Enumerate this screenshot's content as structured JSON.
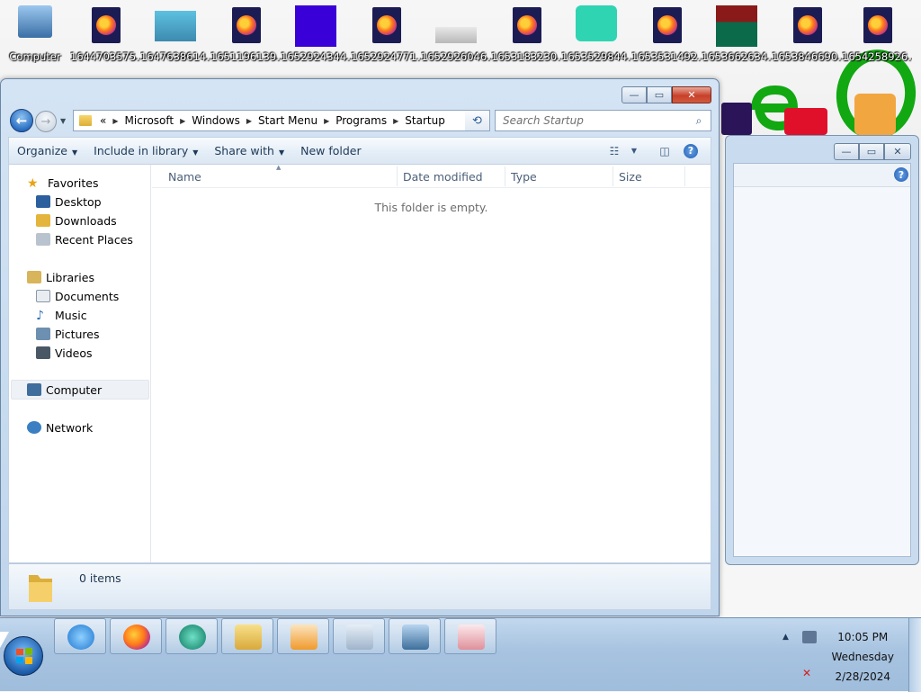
{
  "desktop": {
    "icons": [
      {
        "label": "Computer",
        "kind": "computer"
      },
      {
        "label": "1644703575....",
        "kind": "firefox-file"
      },
      {
        "label": "1647638614....",
        "kind": "image-cat"
      },
      {
        "label": "1651196139....",
        "kind": "firefox-file"
      },
      {
        "label": "1652924344....",
        "kind": "image-purple"
      },
      {
        "label": "1652924771....",
        "kind": "firefox-file"
      },
      {
        "label": "1652926046....",
        "kind": "image-gray"
      },
      {
        "label": "1653183230....",
        "kind": "firefox-file"
      },
      {
        "label": "1653529844....",
        "kind": "image-teal"
      },
      {
        "label": "1653531492....",
        "kind": "firefox-file"
      },
      {
        "label": "1653662634....",
        "kind": "image-fox"
      },
      {
        "label": "1653846690....",
        "kind": "firefox-file"
      },
      {
        "label": "1654258926....",
        "kind": "firefox-file"
      }
    ]
  },
  "explorer": {
    "caption_buttons": {
      "minimize": "—",
      "maximize": "▭",
      "close": "✕"
    },
    "nav": {
      "back": "←",
      "forward": "→",
      "overflow": "«"
    },
    "breadcrumb": [
      "Microsoft",
      "Windows",
      "Start Menu",
      "Programs",
      "Startup"
    ],
    "search_placeholder": "Search Startup",
    "toolbar": {
      "organize": "Organize",
      "include_in_library": "Include in library",
      "share_with": "Share with",
      "new_folder": "New folder",
      "help": "?"
    },
    "nav_pane": {
      "favorites": "Favorites",
      "favorites_items": [
        "Desktop",
        "Downloads",
        "Recent Places"
      ],
      "libraries": "Libraries",
      "libraries_items": [
        "Documents",
        "Music",
        "Pictures",
        "Videos"
      ],
      "computer": "Computer",
      "network": "Network"
    },
    "columns": [
      "Name",
      "Date modified",
      "Type",
      "Size"
    ],
    "empty_message": "This folder is empty.",
    "details": {
      "item_count": "0 items"
    }
  },
  "taskbar": {
    "apps": [
      "internet-explorer",
      "firefox",
      "media-center",
      "file-explorer",
      "media-player",
      "calculator",
      "photo-viewer",
      "snipping-tool"
    ],
    "clock": {
      "time": "10:05 PM",
      "day": "Wednesday",
      "date": "2/28/2024"
    }
  },
  "colors": {
    "accent": "#1d5ab2",
    "window_frame": "#c9dcef",
    "taskbar": "#a7c3e0"
  }
}
